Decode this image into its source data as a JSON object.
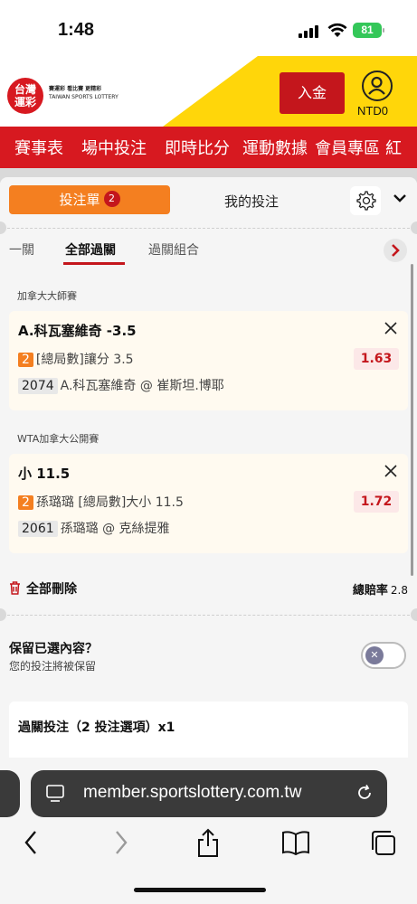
{
  "status": {
    "time": "1:48",
    "battery": "81"
  },
  "header": {
    "logo_line1": "台灣",
    "logo_line2": "運彩",
    "logo_tagline": "賽運彩 看比賽 更精彩",
    "logo_sub": "TAIWAN SPORTS LOTTERY",
    "deposit_label": "入金",
    "account_label": "NTD0"
  },
  "nav": {
    "items": [
      "賽事表",
      "場中投注",
      "即時比分",
      "運動數據",
      "會員專區",
      "紅"
    ]
  },
  "betslip": {
    "tab_bets": "投注單",
    "tab_bets_count": "2",
    "tab_my_bets": "我的投注"
  },
  "subtabs": {
    "single": "一關",
    "all_parlay": "全部過關",
    "parlay_combo": "過關組合"
  },
  "selections": [
    {
      "league": "加拿大大師賽",
      "title": "A.科瓦塞維奇 -3.5",
      "num": "2",
      "market": "[總局數]讓分 3.5",
      "odds": "1.63",
      "code": "2074",
      "match": "A.科瓦塞維奇 @ 崔斯坦.博耶"
    },
    {
      "league": "WTA加拿大公開賽",
      "title": "小 11.5",
      "num": "2",
      "market": "孫璐璐 [總局數]大小 11.5",
      "odds": "1.72",
      "code": "2061",
      "match": "孫璐璐 @ 克絲提雅"
    }
  ],
  "footer": {
    "delete_all": "全部刪除",
    "total_odds_label": "總賠率",
    "total_odds_value": "2.8",
    "keep_title": "保留已選內容？",
    "keep_sub": "您的投注將被保留",
    "keep_enabled": false,
    "parlay_title": "過關投注（2 投注選項）x1"
  },
  "browser": {
    "url": "member.sportslottery.com.tw"
  },
  "colors": {
    "brand_red": "#d71920",
    "accent_orange": "#f47f20",
    "header_yellow": "#ffd60a"
  }
}
